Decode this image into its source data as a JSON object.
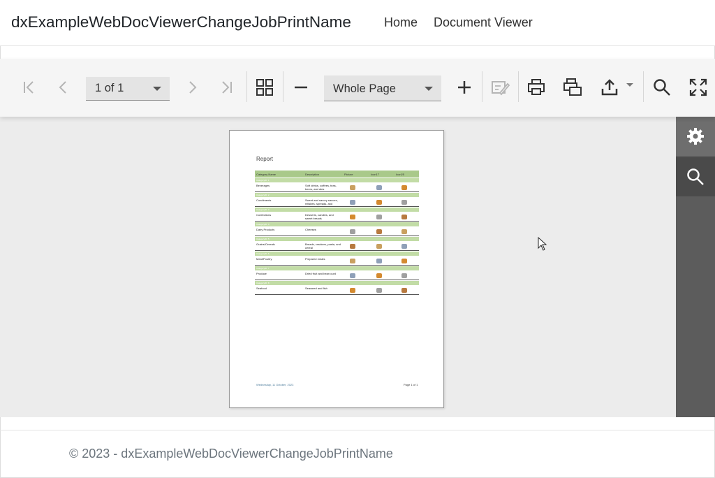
{
  "navbar": {
    "brand": "dxExampleWebDocViewerChangeJobPrintName",
    "links": [
      "Home",
      "Document Viewer"
    ]
  },
  "toolbar": {
    "page_selector_value": "1 of 1",
    "zoom_value": "Whole Page",
    "icons": [
      "first-page-icon",
      "prev-page-icon",
      "next-page-icon",
      "last-page-icon",
      "multipage-icon",
      "zoom-out-icon",
      "zoom-in-icon",
      "editing-fields-icon",
      "print-icon",
      "print-page-icon",
      "export-icon",
      "search-icon",
      "fullscreen-icon"
    ]
  },
  "side_panel": {
    "icons": [
      "gear-icon",
      "search-icon"
    ]
  },
  "report_page": {
    "title": "Report",
    "columns": [
      "Category Name",
      "Description",
      "Picture",
      "Icon17",
      "Icon25"
    ],
    "rows": [
      {
        "group": "CategoryID: 1",
        "name": "Beverages",
        "desc": "Soft drinks, coffees, teas, beers, and ales"
      },
      {
        "group": "CategoryID: 2",
        "name": "Condiments",
        "desc": "Sweet and savory sauces, relishes, spreads, and seasonings"
      },
      {
        "group": "CategoryID: 3",
        "name": "Confections",
        "desc": "Desserts, candies, and sweet breads"
      },
      {
        "group": "CategoryID: 4",
        "name": "Dairy Products",
        "desc": "Cheeses"
      },
      {
        "group": "CategoryID: 5",
        "name": "Grains/Cereals",
        "desc": "Breads, crackers, pasta, and cereal"
      },
      {
        "group": "CategoryID: 6",
        "name": "Meat/Poultry",
        "desc": "Prepared meats"
      },
      {
        "group": "CategoryID: 7",
        "name": "Produce",
        "desc": "Dried fruit and bean curd"
      },
      {
        "group": "CategoryID: 8",
        "name": "Seafood",
        "desc": "Seaweed and fish"
      }
    ],
    "footer_left": "Wednesday, 11 October, 2023",
    "footer_right": "Page 1 of 1"
  },
  "footer": {
    "text": "© 2023 - dxExampleWebDocViewerChangeJobPrintName"
  },
  "colors": {
    "toolbar_bg": "#f5f5f5",
    "viewer_bg": "#ececec",
    "side_panel_bg": "#5c5c5c",
    "table_header": "#a9c98a",
    "table_group": "#c2dca6"
  }
}
